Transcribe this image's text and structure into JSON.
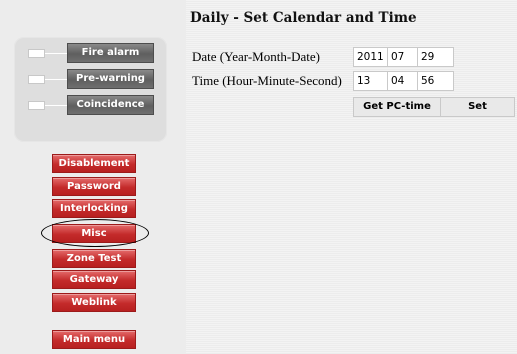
{
  "status_panel": {
    "items": [
      {
        "label": "Fire alarm"
      },
      {
        "label": "Pre-warning"
      },
      {
        "label": "Coincidence"
      }
    ]
  },
  "menu": {
    "items": [
      {
        "label": "Disablement"
      },
      {
        "label": "Password"
      },
      {
        "label": "Interlocking"
      },
      {
        "label": "Misc",
        "highlighted": true
      },
      {
        "label": "Zone Test"
      },
      {
        "label": "Gateway"
      },
      {
        "label": "Weblink"
      }
    ],
    "main_menu_label": "Main menu"
  },
  "main": {
    "title": "Daily - Set Calendar and Time",
    "date_label": "Date (Year-Month-Date)",
    "time_label": "Time (Hour-Minute-Second)",
    "date": {
      "year": "2011",
      "month": "07",
      "day": "29"
    },
    "time": {
      "hour": "13",
      "minute": "04",
      "second": "56"
    },
    "get_pc_time_label": "Get PC-time",
    "set_label": "Set"
  },
  "colors": {
    "menu_button": "#c42b2b",
    "status_label": "#6a6a6a"
  }
}
